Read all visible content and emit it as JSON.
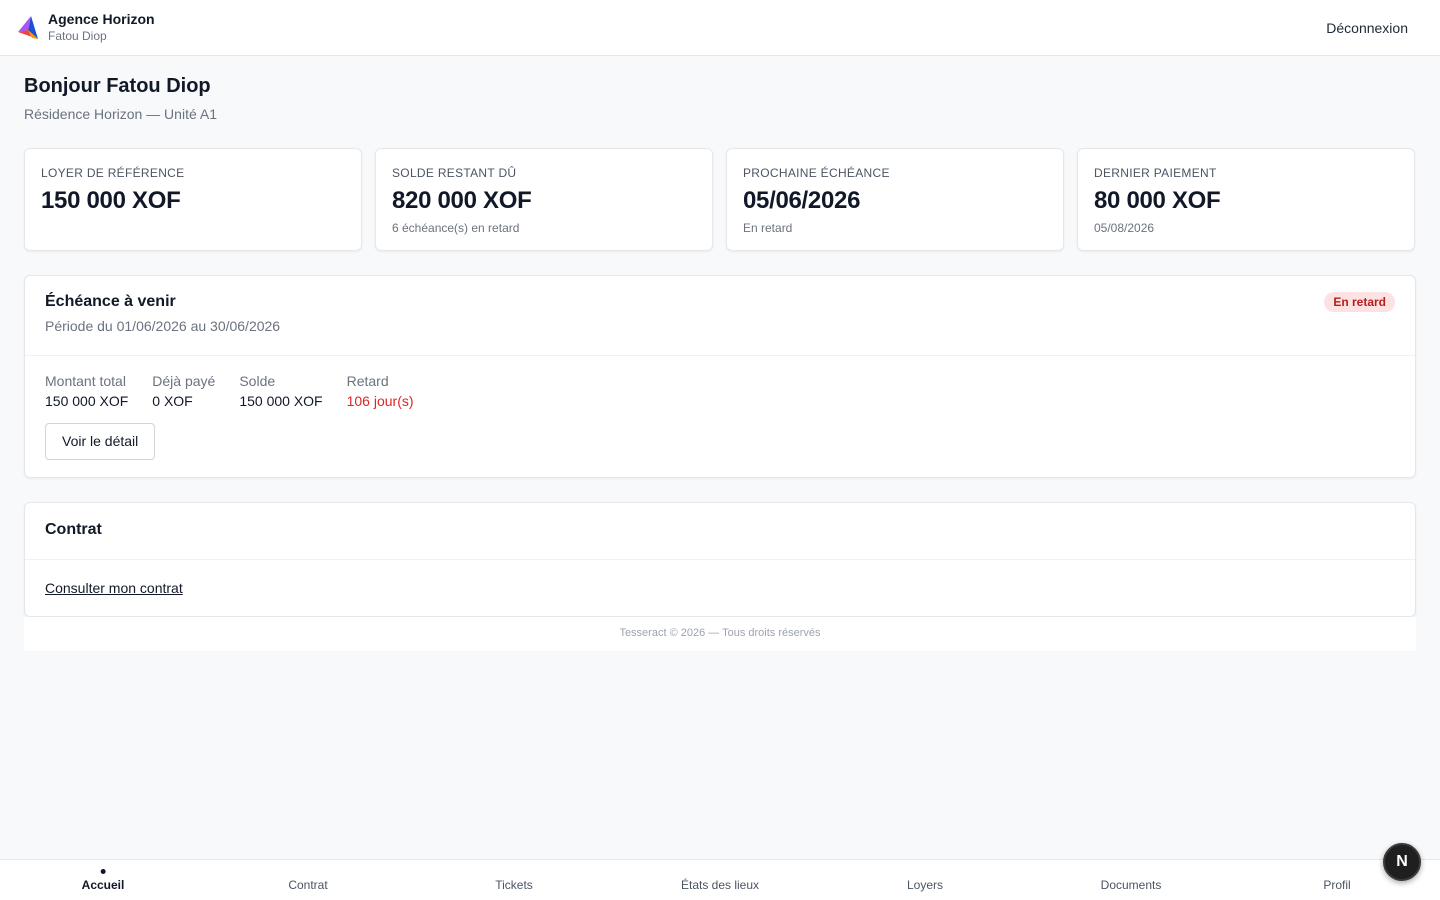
{
  "app": {
    "brand_name": "Agence Horizon",
    "user_name": "Fatou Diop",
    "logout_label": "Déconnexion"
  },
  "page": {
    "greeting": "Bonjour Fatou Diop",
    "residence": "Résidence Horizon — Unité A1"
  },
  "stats": [
    {
      "label": "LOYER DE RÉFÉRENCE",
      "value": "150 000 XOF",
      "sub": ""
    },
    {
      "label": "SOLDE RESTANT DÛ",
      "value": "820 000 XOF",
      "sub": "6 échéance(s) en retard"
    },
    {
      "label": "PROCHAINE ÉCHÉANCE",
      "value": "05/06/2026",
      "sub": "En retard"
    },
    {
      "label": "DERNIER PAIEMENT",
      "value": "80 000 XOF",
      "sub": "05/08/2026"
    }
  ],
  "due": {
    "title": "Échéance à venir",
    "period": "Période du 01/06/2026 au 30/06/2026",
    "badge": "En retard",
    "fields": [
      {
        "label": "Montant total",
        "value": "150 000 XOF"
      },
      {
        "label": "Déjà payé",
        "value": "0 XOF"
      },
      {
        "label": "Solde",
        "value": "150 000 XOF"
      },
      {
        "label": "Retard",
        "value": "106 jour(s)"
      }
    ],
    "detail_button": "Voir le détail"
  },
  "contract": {
    "title": "Contrat",
    "link": "Consulter mon contrat"
  },
  "footer": "Tesseract © 2026 — Tous droits réservés",
  "nav": [
    {
      "label": "Accueil",
      "active": true
    },
    {
      "label": "Contrat",
      "active": false
    },
    {
      "label": "Tickets",
      "active": false
    },
    {
      "label": "États des lieux",
      "active": false
    },
    {
      "label": "Loyers",
      "active": false
    },
    {
      "label": "Documents",
      "active": false
    },
    {
      "label": "Profil",
      "active": false
    }
  ],
  "dev_badge": "N",
  "colors": {
    "danger": "#dc2626",
    "badge_bg": "#fde2e4",
    "badge_text": "#b91c1c"
  }
}
